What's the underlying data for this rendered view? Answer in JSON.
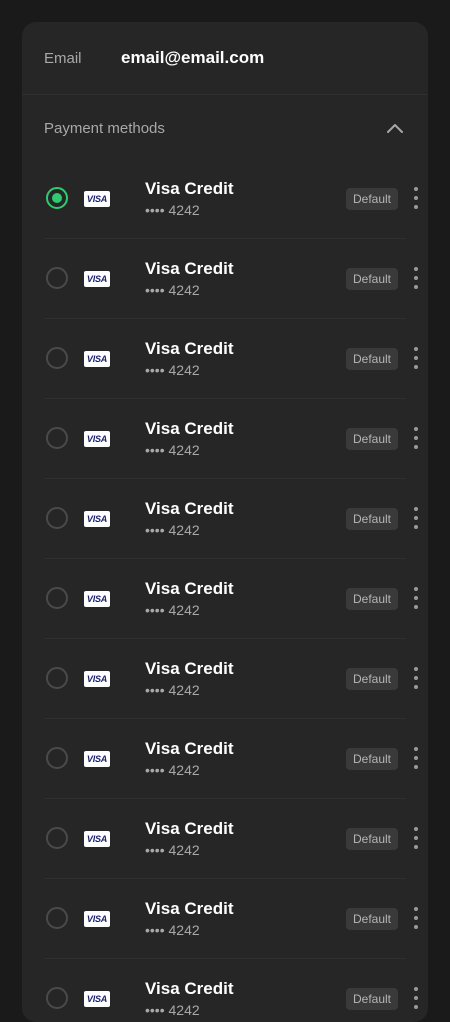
{
  "email": {
    "label": "Email",
    "value": "email@email.com"
  },
  "payment_methods": {
    "title": "Payment methods",
    "selected_index": 0,
    "items": [
      {
        "brand": "VISA",
        "name": "Visa Credit",
        "number": "•••• 4242",
        "badge": "Default"
      },
      {
        "brand": "VISA",
        "name": "Visa Credit",
        "number": "•••• 4242",
        "badge": "Default"
      },
      {
        "brand": "VISA",
        "name": "Visa Credit",
        "number": "•••• 4242",
        "badge": "Default"
      },
      {
        "brand": "VISA",
        "name": "Visa Credit",
        "number": "•••• 4242",
        "badge": "Default"
      },
      {
        "brand": "VISA",
        "name": "Visa Credit",
        "number": "•••• 4242",
        "badge": "Default"
      },
      {
        "brand": "VISA",
        "name": "Visa Credit",
        "number": "•••• 4242",
        "badge": "Default"
      },
      {
        "brand": "VISA",
        "name": "Visa Credit",
        "number": "•••• 4242",
        "badge": "Default"
      },
      {
        "brand": "VISA",
        "name": "Visa Credit",
        "number": "•••• 4242",
        "badge": "Default"
      },
      {
        "brand": "VISA",
        "name": "Visa Credit",
        "number": "•••• 4242",
        "badge": "Default"
      },
      {
        "brand": "VISA",
        "name": "Visa Credit",
        "number": "•••• 4242",
        "badge": "Default"
      },
      {
        "brand": "VISA",
        "name": "Visa Credit",
        "number": "•••• 4242",
        "badge": "Default"
      }
    ]
  },
  "colors": {
    "background": "#1a1a1a",
    "card": "#262626",
    "accent_selected": "#2ecc71",
    "badge_bg": "#3a3a3a"
  },
  "icons": {
    "collapse": "chevron-up-icon",
    "more": "more-vertical-icon",
    "card_brand": "visa-icon"
  }
}
